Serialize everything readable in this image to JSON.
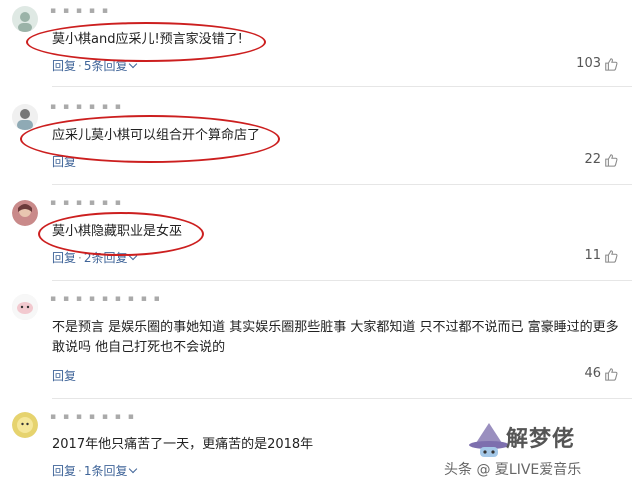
{
  "comments": [
    {
      "text": "莫小棋and应采儿!预言家没错了!",
      "reply": "回复",
      "more": "5条回复",
      "likes": "103"
    },
    {
      "text": "应采儿莫小棋可以组合开个算命店了",
      "reply": "回复",
      "more": "",
      "likes": "22"
    },
    {
      "text": "莫小棋隐藏职业是女巫",
      "reply": "回复",
      "more": "2条回复",
      "likes": "11"
    },
    {
      "text": "不是预言 是娱乐圈的事她知道 其实娱乐圈那些脏事 大家都知道 只不过都不说而已 富豪睡过的更多敢说吗 他自己打死也不会说的",
      "reply": "回复",
      "more": "",
      "likes": "46"
    },
    {
      "text": "2017年他只痛苦了一天，更痛苦的是2018年",
      "reply": "回复",
      "more": "1条回复",
      "likes": ""
    }
  ],
  "watermark": {
    "title": "解梦佬",
    "sub": "头条 @ 夏LIVE爱音乐"
  },
  "colors": {
    "accent": "#406599",
    "highlight": "#cc1f1f"
  }
}
